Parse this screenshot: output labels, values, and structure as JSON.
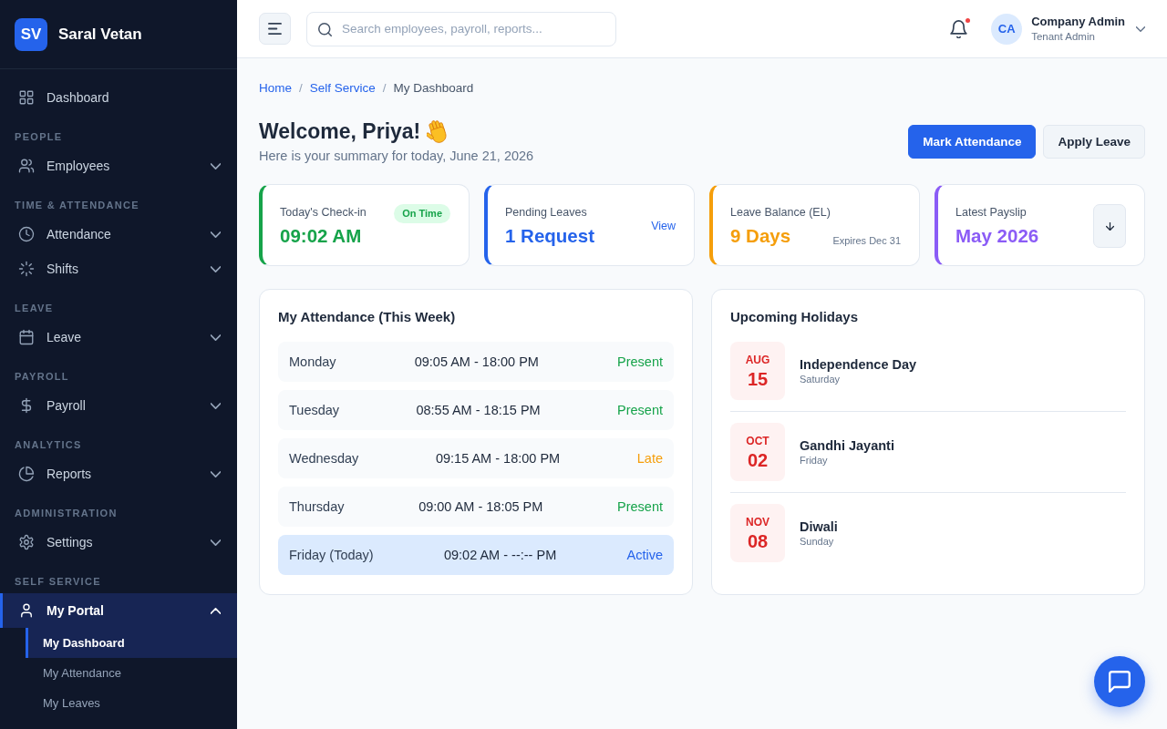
{
  "sidebar": {
    "logo": {
      "initials": "SV",
      "name": "Saral Vetan"
    },
    "groups": [
      {
        "items": [
          {
            "label": "Dashboard",
            "selected": false
          }
        ]
      },
      {
        "heading": "PEOPLE",
        "items": [
          {
            "label": "Employees",
            "selected": false,
            "expanded": false
          }
        ]
      },
      {
        "heading": "TIME & ATTENDANCE",
        "items": [
          {
            "label": "Attendance",
            "selected": false,
            "expanded": false
          },
          {
            "label": "Shifts",
            "selected": false,
            "expanded": false
          }
        ]
      },
      {
        "heading": "LEAVE",
        "items": [
          {
            "label": "Leave",
            "selected": false,
            "expanded": false
          }
        ]
      },
      {
        "heading": "PAYROLL",
        "items": [
          {
            "label": "Payroll",
            "selected": false,
            "expanded": false
          }
        ]
      },
      {
        "heading": "ANALYTICS",
        "items": [
          {
            "label": "Reports",
            "selected": false,
            "expanded": false
          }
        ]
      },
      {
        "heading": "ADMINISTRATION",
        "items": [
          {
            "label": "Settings",
            "selected": false,
            "expanded": false
          }
        ]
      },
      {
        "heading": "SELF SERVICE",
        "items": [
          {
            "label": "My Portal",
            "selected": true,
            "expanded": true,
            "children": [
              {
                "label": "My Dashboard",
                "selected": true
              },
              {
                "label": "My Attendance",
                "selected": false
              },
              {
                "label": "My Leaves",
                "selected": false
              }
            ]
          }
        ]
      }
    ]
  },
  "header": {
    "search": {
      "placeholder": "Search employees, payroll, reports..."
    },
    "notifications": {
      "unread": true
    },
    "user": {
      "initials": "CA",
      "name": "Company Admin",
      "role": "Tenant Admin"
    }
  },
  "breadcrumb": [
    {
      "label": "Home",
      "current": false,
      "separator": "/"
    },
    {
      "label": "Self Service",
      "current": false,
      "separator": "/"
    },
    {
      "label": "My Dashboard",
      "current": true
    }
  ],
  "welcome": {
    "title": "Welcome, Priya!",
    "subtitle": "Here is your summary for today, June 21, 2026"
  },
  "actions": [
    {
      "label": "Mark Attendance",
      "kind": "primary"
    },
    {
      "label": "Apply Leave",
      "kind": "secondary"
    }
  ],
  "stats": [
    {
      "label": "Today's Check-in",
      "value": "09:02 AM",
      "color": "#16a34a",
      "badge": "On Time"
    },
    {
      "label": "Pending Leaves",
      "value": "1 Request",
      "color": "#2563eb",
      "link": "View"
    },
    {
      "label": "Leave Balance (EL)",
      "value": "9 Days",
      "color": "#f59e0b",
      "note": "Expires Dec 31"
    },
    {
      "label": "Latest Payslip",
      "value": "May 2026",
      "color": "#8b5cf6",
      "download": true
    }
  ],
  "attendance": {
    "title": "My Attendance (This Week)",
    "rows": [
      {
        "day": "Monday",
        "hours": "09:05 AM - 18:00 PM",
        "status": "Present",
        "color": "#16a34a",
        "today": false
      },
      {
        "day": "Tuesday",
        "hours": "08:55 AM - 18:15 PM",
        "status": "Present",
        "color": "#16a34a",
        "today": false
      },
      {
        "day": "Wednesday",
        "hours": "09:15 AM - 18:00 PM",
        "status": "Late",
        "color": "#f59e0b",
        "today": false
      },
      {
        "day": "Thursday",
        "hours": "09:00 AM - 18:05 PM",
        "status": "Present",
        "color": "#16a34a",
        "today": false
      },
      {
        "day": "Friday (Today)",
        "hours": "09:02 AM - --:-- PM",
        "status": "Active",
        "color": "#2563eb",
        "today": true
      }
    ]
  },
  "holidays": {
    "title": "Upcoming Holidays",
    "items": [
      {
        "month": "AUG",
        "day": "15",
        "name": "Independence Day",
        "weekday": "Saturday"
      },
      {
        "month": "OCT",
        "day": "02",
        "name": "Gandhi Jayanti",
        "weekday": "Friday"
      },
      {
        "month": "NOV",
        "day": "08",
        "name": "Diwali",
        "weekday": "Sunday"
      }
    ]
  }
}
